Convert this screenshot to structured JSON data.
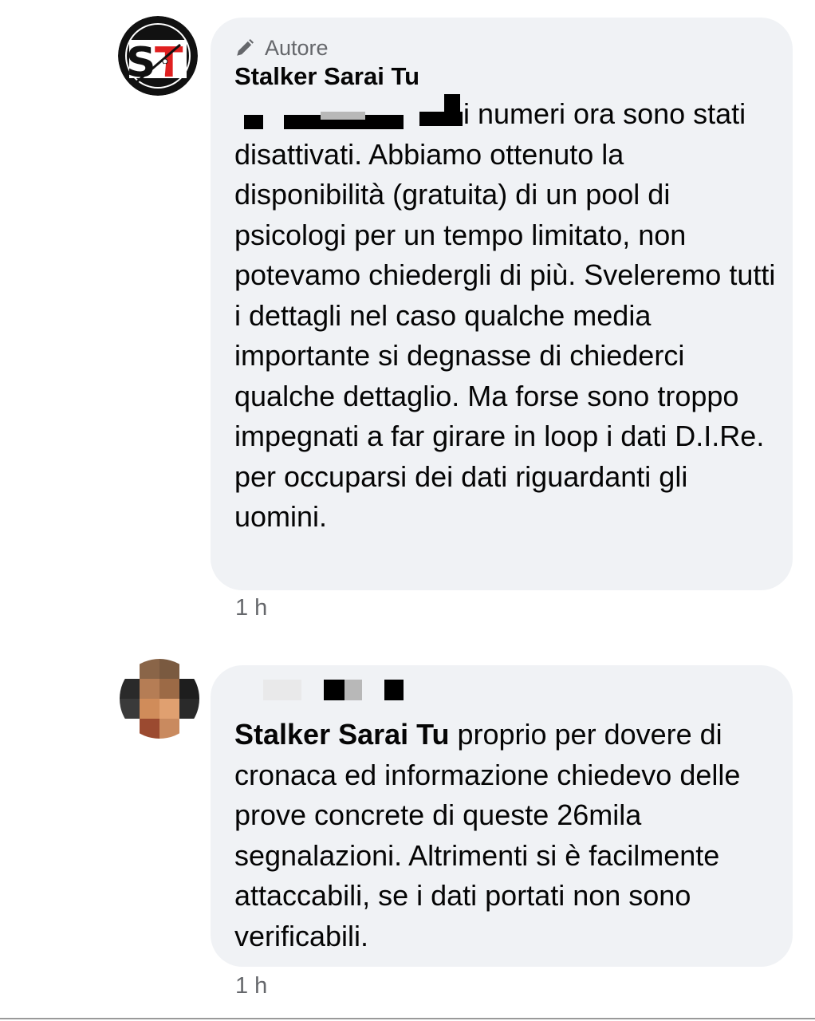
{
  "comments": [
    {
      "badge_label": "Autore",
      "author": "Stalker Sarai Tu",
      "body": "i numeri ora sono stati disattivati. Abbiamo ottenuto la disponibilità (gratuita) di un pool di psicologi per un tempo limitato, non potevamo chiedergli di più. Sveleremo tutti i dettagli nel caso qualche media importante si degnasse di chiederci qualche dettaglio. Ma forse sono troppo impegnati a far girare in loop i dati D.I.Re. per occuparsi dei dati riguardanti gli uomini.",
      "time": "1 h",
      "avatar_colors": {
        "outer": "#111111",
        "inner": "#ffffff",
        "s": "#111111",
        "t": "#e02020"
      }
    },
    {
      "mention": "Stalker Sarai Tu",
      "body": " proprio per dovere di cronaca ed informazione chiedevo delle prove concrete di queste 26mila segnalazioni. Altrimenti si è facilmente attaccabili, se i dati portati non sono verificabili.",
      "time": "1 h"
    }
  ],
  "theme": {
    "bubble_bg": "#f0f2f5",
    "muted_text": "#65676b",
    "text": "#050505"
  }
}
